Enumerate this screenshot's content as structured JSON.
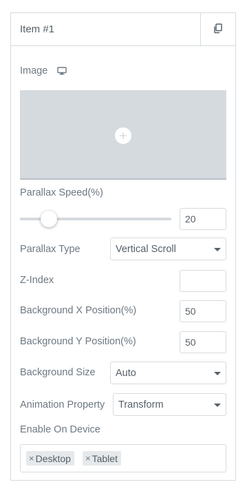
{
  "header": {
    "title": "Item #1",
    "copy_icon": "copy-icon"
  },
  "image": {
    "label": "Image",
    "device_icon": "monitor-icon",
    "add_icon": "plus-icon"
  },
  "parallax_speed": {
    "label": "Parallax Speed(%)",
    "value": "20",
    "slider_fraction": 0.19
  },
  "parallax_type": {
    "label": "Parallax Type",
    "value": "Vertical Scroll"
  },
  "z_index": {
    "label": "Z-Index",
    "value": ""
  },
  "bg_x": {
    "label": "Background X Position(%)",
    "value": "50"
  },
  "bg_y": {
    "label": "Background Y Position(%)",
    "value": "50"
  },
  "bg_size": {
    "label": "Background Size",
    "value": "Auto"
  },
  "animation_property": {
    "label": "Animation Property",
    "value": "Transform"
  },
  "enable_on_device": {
    "label": "Enable On Device",
    "remove_glyph": "×",
    "tags": [
      "Desktop",
      "Tablet"
    ]
  },
  "colors": {
    "border": "#d5dadf",
    "text": "#6d7882",
    "value_text": "#556068",
    "image_placeholder": "#d5dadf",
    "tag_bg": "#e6e9ec"
  }
}
